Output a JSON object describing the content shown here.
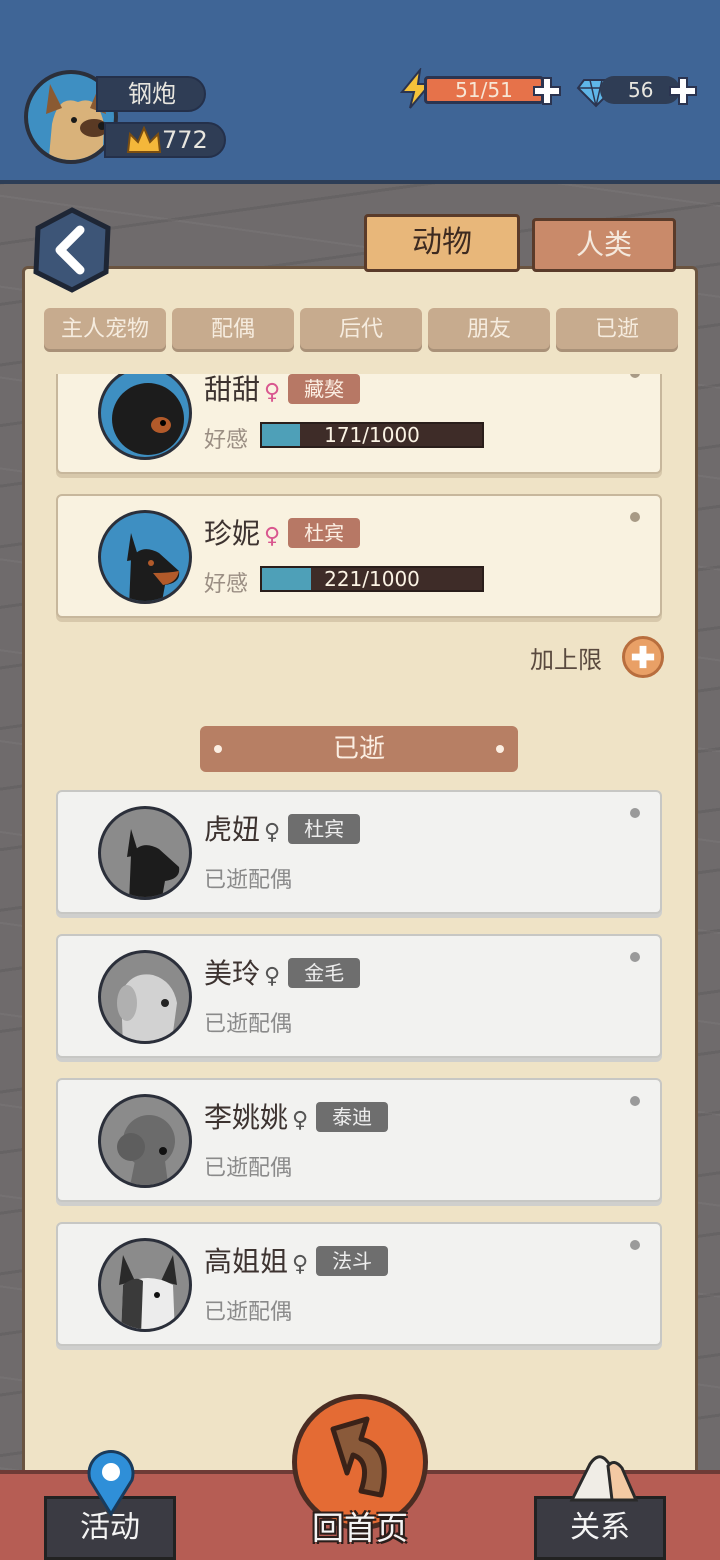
{
  "player": {
    "name": "钢炮",
    "score": "772"
  },
  "resources": {
    "energy": "51/51",
    "gems": "56"
  },
  "tabs": {
    "animal": "动物",
    "human": "人类"
  },
  "subtabs": [
    "主人宠物",
    "配偶",
    "后代",
    "朋友",
    "已逝"
  ],
  "active_cards": [
    {
      "name": "甜甜",
      "gender": "♀",
      "breed": "藏獒",
      "affinity_label": "好感",
      "affinity_text": "171/1000",
      "affinity_value": 171,
      "affinity_max": 1000
    },
    {
      "name": "珍妮",
      "gender": "♀",
      "breed": "杜宾",
      "affinity_label": "好感",
      "affinity_text": "221/1000",
      "affinity_value": 221,
      "affinity_max": 1000
    }
  ],
  "add_limit_label": "加上限",
  "deceased_section_title": "已逝",
  "deceased_cards": [
    {
      "name": "虎妞",
      "gender": "♀",
      "breed": "杜宾",
      "status": "已逝配偶"
    },
    {
      "name": "美玲",
      "gender": "♀",
      "breed": "金毛",
      "status": "已逝配偶"
    },
    {
      "name": "李姚姚",
      "gender": "♀",
      "breed": "泰迪",
      "status": "已逝配偶"
    },
    {
      "name": "高姐姐",
      "gender": "♀",
      "breed": "法斗",
      "status": "已逝配偶"
    }
  ],
  "bottom_nav": {
    "activity": "活动",
    "home": "回首页",
    "relations": "关系"
  }
}
